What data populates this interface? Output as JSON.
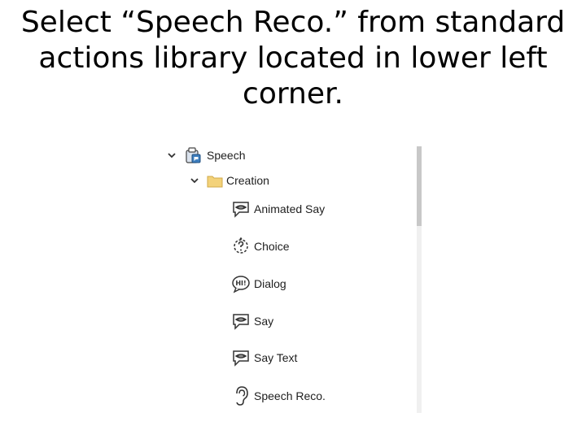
{
  "slide": {
    "title_line1": "Select “Speech Reco.” from standard",
    "title_line2": "actions library located in lower left",
    "title_line3": "corner."
  },
  "tree": {
    "root": {
      "label": "Speech",
      "icon": "speech-library-icon",
      "expanded": true
    },
    "folder": {
      "label": "Creation",
      "icon": "folder-icon",
      "expanded": true
    },
    "items": [
      {
        "label": "Animated Say",
        "icon": "speech-bubble-lips-icon"
      },
      {
        "label": "Choice",
        "icon": "question-choice-icon"
      },
      {
        "label": "Dialog",
        "icon": "hi-bubble-icon"
      },
      {
        "label": "Say",
        "icon": "speech-bubble-lips-icon"
      },
      {
        "label": "Say Text",
        "icon": "speech-bubble-lips-icon"
      },
      {
        "label": "Speech Reco.",
        "icon": "ear-icon"
      }
    ]
  },
  "colors": {
    "folder": "#f3d27a",
    "icon_stroke": "#333333",
    "scroll_track": "#f0f0f0",
    "scroll_thumb": "#c8c8c8"
  }
}
